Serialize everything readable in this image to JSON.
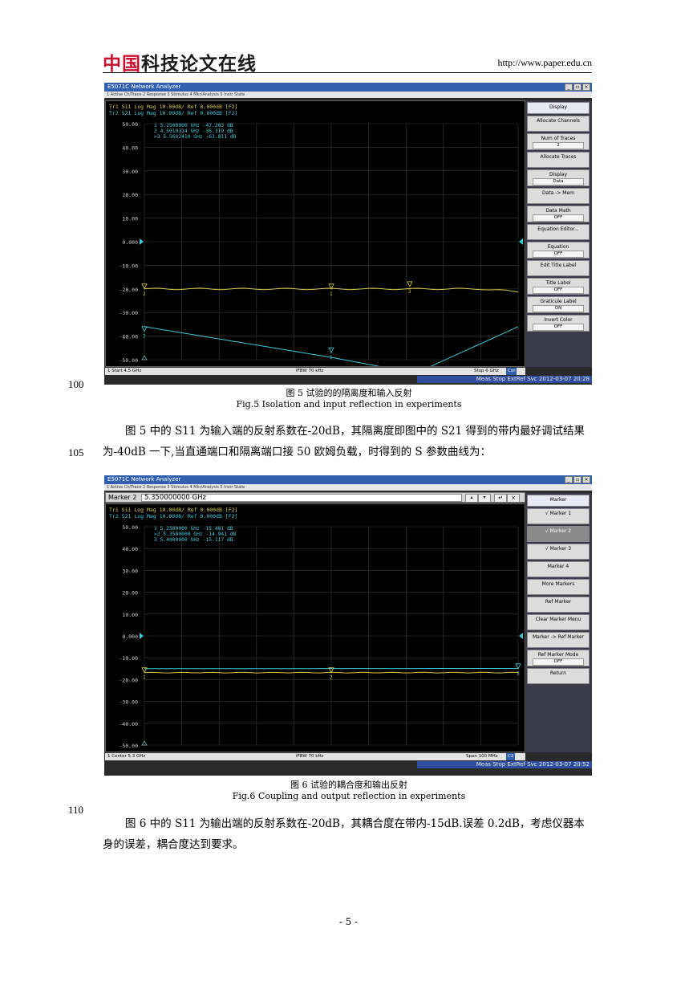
{
  "header": {
    "logo_red": "中国",
    "logo_rest": "科技论文在线",
    "url": "http://www.paper.edu.cn"
  },
  "line_numbers": [
    "100",
    "105",
    "110"
  ],
  "figure5": {
    "window_title": "E5071C Network Analyzer",
    "menu": "1 Active Ch/Trace   2 Response   3 Stimulus   4 Mkr/Analysis   5 Instr State",
    "trace1": "Tr1  S11  Log Mag  10.00dB/ Ref  0.000dB  [F2]",
    "trace2": "Tr2  S21  Log Mag  10.00dB/ Ref  0.000dB  [F2]",
    "markers": [
      "1    5.2500000 GHz  -47.203  dB",
      "2    4.5019314 GHz  -36.319  dB",
      ">3   5.5602410 GHz  -63.811  dB"
    ],
    "y_ticks": [
      "50.00",
      "40.00",
      "30.00",
      "20.00",
      "10.00",
      "0.000",
      "-10.00",
      "-20.00",
      "-30.00",
      "-40.00",
      "-50.00"
    ],
    "status_left": "1  Start 4.5 GHz",
    "status_mid": "IFBW 70 kHz",
    "status_right": "Stop 6 GHz",
    "status_flag": "Cor",
    "status_bottom": "Meas   Stop   ExtRef   Svc   2012-03-07  20:28",
    "softkeys": [
      {
        "label": "Display",
        "value": ""
      },
      {
        "label": "Allocate Channels",
        "value": ""
      },
      {
        "label": "Num of Traces",
        "value": "2"
      },
      {
        "label": "Allocate Traces",
        "value": ""
      },
      {
        "label": "Display",
        "value": "Data"
      },
      {
        "label": "Data -> Mem",
        "value": ""
      },
      {
        "label": "Data Math",
        "value": "OFF"
      },
      {
        "label": "Equation Editor...",
        "value": ""
      },
      {
        "label": "Equation",
        "value": "OFF"
      },
      {
        "label": "Edit Title Label",
        "value": ""
      },
      {
        "label": "Title Label",
        "value": "OFF"
      },
      {
        "label": "Graticule Label",
        "value": "ON"
      },
      {
        "label": "Invert Color",
        "value": "OFF"
      }
    ],
    "caption_cn": "图 5  试验的的隔离度和输入反射",
    "caption_en": "Fig.5 Isolation and input reflection in experiments"
  },
  "paragraph1": "图 5 中的 S11 为输入端的反射系数在-20dB，其隔离度即图中的 S21 得到的带内最好调试结果为-40dB 一下,当直通端口和隔离端口接 50 欧姆负载，时得到的 S 参数曲线为：",
  "figure6": {
    "window_title": "E5071C Network Analyzer",
    "menu": "1 Active Ch/Trace   2 Response   3 Stimulus   4 Mkr/Analysis   5 Instr State",
    "marker_label": "Marker 2",
    "marker_value": "5.350000000 GHz",
    "trace1": "Tr1  S11  Log Mag  10.00dB/ Ref  0.000dB  [F2]",
    "trace2": "Tr2  S21  Log Mag  10.00dB/ Ref  0.000dB  [F2]",
    "markers": [
      "1    5.2500000 GHz  -15.481  dB",
      ">2   5.3500000 GHz  -14.941  dB",
      "3    5.4000000 GHz  -15.117  dB"
    ],
    "y_ticks": [
      "50.00",
      "40.00",
      "30.00",
      "20.00",
      "10.00",
      "0.000",
      "-10.00",
      "-20.00",
      "-30.00",
      "-40.00",
      "-50.00"
    ],
    "status_left": "1  Center 5.3 GHz",
    "status_mid": "IFBW 70 kHz",
    "status_right": "Span 100 MHz",
    "status_flag": "C2",
    "status_bottom": "Meas   Stop   ExtRef   Svc   2012-03-07  20:52",
    "softkeys": [
      {
        "label": "Marker",
        "value": ""
      },
      {
        "label": "√   Marker 1",
        "value": ""
      },
      {
        "label": "√   Marker 2",
        "value": ""
      },
      {
        "label": "√   Marker 3",
        "value": ""
      },
      {
        "label": "Marker 4",
        "value": ""
      },
      {
        "label": "More Markers",
        "value": ""
      },
      {
        "label": "Ref Marker",
        "value": ""
      },
      {
        "label": "Clear Marker Menu",
        "value": ""
      },
      {
        "label": "Marker -> Ref Marker",
        "value": ""
      },
      {
        "label": "Ref Marker Mode",
        "value": "OFF"
      },
      {
        "label": "Return",
        "value": ""
      }
    ],
    "caption_cn": "图 6  试验的耦合度和输出反射",
    "caption_en": "Fig.6 Coupling and output reflection in experiments"
  },
  "paragraph2": "图 6 中的 S11 为输出端的反射系数在-20dB，其耦合度在带内-15dB.误差 0.2dB，考虑仪器本身的误差，耦合度达到要求。",
  "page_number": "- 5 -",
  "colors": {
    "trace_s11": "#d8c84a",
    "trace_s21": "#3fc8d8",
    "plot_bg": "#000000",
    "grid": "#3a3a3a",
    "logo_red": "#c8102e"
  }
}
